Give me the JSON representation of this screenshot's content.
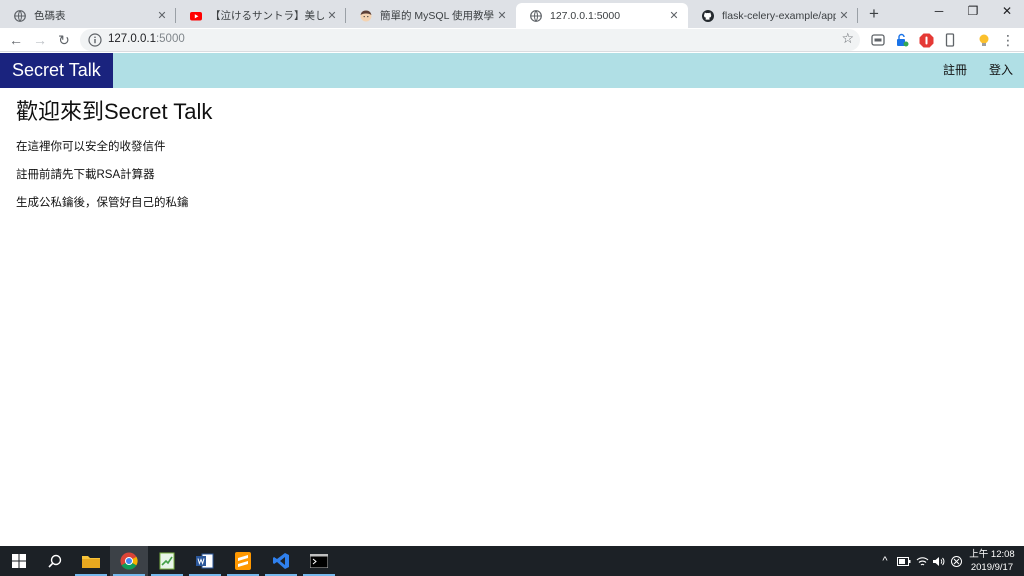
{
  "browser": {
    "tabs": [
      {
        "title": "色碼表",
        "icon": "globe-icon",
        "active": false
      },
      {
        "title": "【泣けるサントラ】美しく切ない",
        "icon": "youtube-icon",
        "active": false
      },
      {
        "title": "簡單的 MySQL 使用教學 - 傑哥",
        "icon": "avatar-icon",
        "active": false
      },
      {
        "title": "127.0.0.1:5000",
        "icon": "globe-icon",
        "active": true
      },
      {
        "title": "flask-celery-example/app.py",
        "icon": "github-icon",
        "active": false
      }
    ],
    "close_glyph": "✕",
    "new_tab_glyph": "+",
    "window_controls": {
      "minimize": "─",
      "restore": "❐",
      "close": "✕"
    },
    "address": {
      "host": "127.0.0.1",
      "port": ":5000"
    },
    "nav": {
      "back": "←",
      "forward": "→",
      "reload": "↻",
      "star": "☆",
      "menu": "⋮"
    }
  },
  "site": {
    "brand": "Secret Talk",
    "nav_links": {
      "register": "註冊",
      "login": "登入"
    },
    "colors": {
      "navbar": "#b0dfe5",
      "brand_bg": "#1a237e"
    },
    "heading": "歡迎來到Secret Talk",
    "paragraphs": [
      "在這裡你可以安全的收發信件",
      "註冊前請先下載RSA計算器",
      "生成公私鑰後，保管好自己的私鑰"
    ]
  },
  "taskbar": {
    "apps": [
      "windows-start-icon",
      "search-icon",
      "file-explorer-icon",
      "chrome-icon",
      "notepad-plus-plus-icon",
      "word-icon",
      "sublime-text-icon",
      "vscode-icon",
      "terminal-icon"
    ],
    "tray": {
      "chevron": "^",
      "volume": "🔈"
    },
    "clock": {
      "time": "上午 12:08",
      "date": "2019/9/17"
    }
  }
}
